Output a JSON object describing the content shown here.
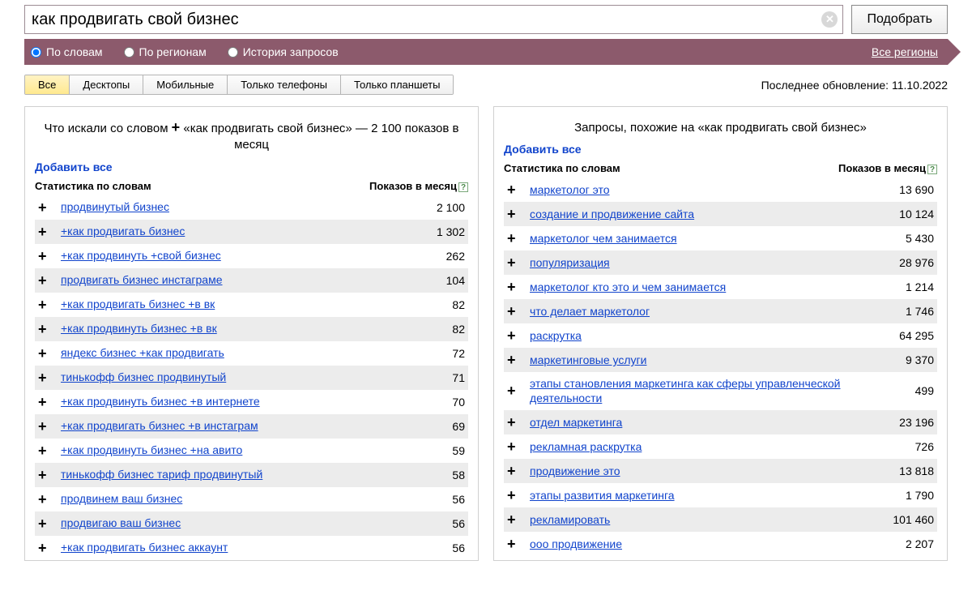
{
  "search": {
    "value": "как продвигать свой бизнес",
    "submit_label": "Подобрать"
  },
  "filter": {
    "options": [
      {
        "label": "По словам",
        "checked": true
      },
      {
        "label": "По регионам",
        "checked": false
      },
      {
        "label": "История запросов",
        "checked": false
      }
    ],
    "regions_link": "Все регионы"
  },
  "device_tabs": [
    {
      "label": "Все",
      "active": true
    },
    {
      "label": "Десктопы",
      "active": false
    },
    {
      "label": "Мобильные",
      "active": false
    },
    {
      "label": "Только телефоны",
      "active": false
    },
    {
      "label": "Только планшеты",
      "active": false
    }
  ],
  "last_update": "Последнее обновление: 11.10.2022",
  "panel_left": {
    "title_prefix": "Что искали со словом ",
    "title_query": "«как продвигать свой бизнес»",
    "title_suffix": " — 2 100 показов в месяц",
    "add_all": "Добавить все",
    "header_stat": "Статистика по словам",
    "header_count": "Показов в месяц",
    "rows": [
      {
        "keyword": "продвинутый бизнес",
        "count": "2 100"
      },
      {
        "keyword": "+как продвигать бизнес",
        "count": "1 302"
      },
      {
        "keyword": "+как продвинуть +свой бизнес",
        "count": "262"
      },
      {
        "keyword": "продвигать бизнес инстаграме",
        "count": "104"
      },
      {
        "keyword": "+как продвигать бизнес +в вк",
        "count": "82"
      },
      {
        "keyword": "+как продвинуть бизнес +в вк",
        "count": "82"
      },
      {
        "keyword": "яндекс бизнес +как продвигать",
        "count": "72"
      },
      {
        "keyword": "тинькофф бизнес продвинутый",
        "count": "71"
      },
      {
        "keyword": "+как продвинуть бизнес +в интернете",
        "count": "70"
      },
      {
        "keyword": "+как продвигать бизнес +в инстаграм",
        "count": "69"
      },
      {
        "keyword": "+как продвинуть бизнес +на авито",
        "count": "59"
      },
      {
        "keyword": "тинькофф бизнес тариф продвинутый",
        "count": "58"
      },
      {
        "keyword": "продвинем ваш бизнес",
        "count": "56"
      },
      {
        "keyword": "продвигаю ваш бизнес",
        "count": "56"
      },
      {
        "keyword": "+как продвигать бизнес аккаунт",
        "count": "56"
      }
    ]
  },
  "panel_right": {
    "title": "Запросы, похожие на «как продвигать свой бизнес»",
    "add_all": "Добавить все",
    "header_stat": "Статистика по словам",
    "header_count": "Показов в месяц",
    "rows": [
      {
        "keyword": "маркетолог это",
        "count": "13 690"
      },
      {
        "keyword": "создание и продвижение сайта",
        "count": "10 124"
      },
      {
        "keyword": "маркетолог чем занимается",
        "count": "5 430"
      },
      {
        "keyword": "популяризация",
        "count": "28 976"
      },
      {
        "keyword": "маркетолог кто это и чем занимается",
        "count": "1 214"
      },
      {
        "keyword": "что делает маркетолог",
        "count": "1 746"
      },
      {
        "keyword": "раскрутка",
        "count": "64 295"
      },
      {
        "keyword": "маркетинговые услуги",
        "count": "9 370"
      },
      {
        "keyword": "этапы становления маркетинга как сферы управленческой деятельности",
        "count": "499"
      },
      {
        "keyword": "отдел маркетинга",
        "count": "23 196"
      },
      {
        "keyword": "рекламная раскрутка",
        "count": "726"
      },
      {
        "keyword": "продвижение это",
        "count": "13 818"
      },
      {
        "keyword": "этапы развития маркетинга",
        "count": "1 790"
      },
      {
        "keyword": "рекламировать",
        "count": "101 460"
      },
      {
        "keyword": "ооо продвижение",
        "count": "2 207"
      }
    ]
  }
}
